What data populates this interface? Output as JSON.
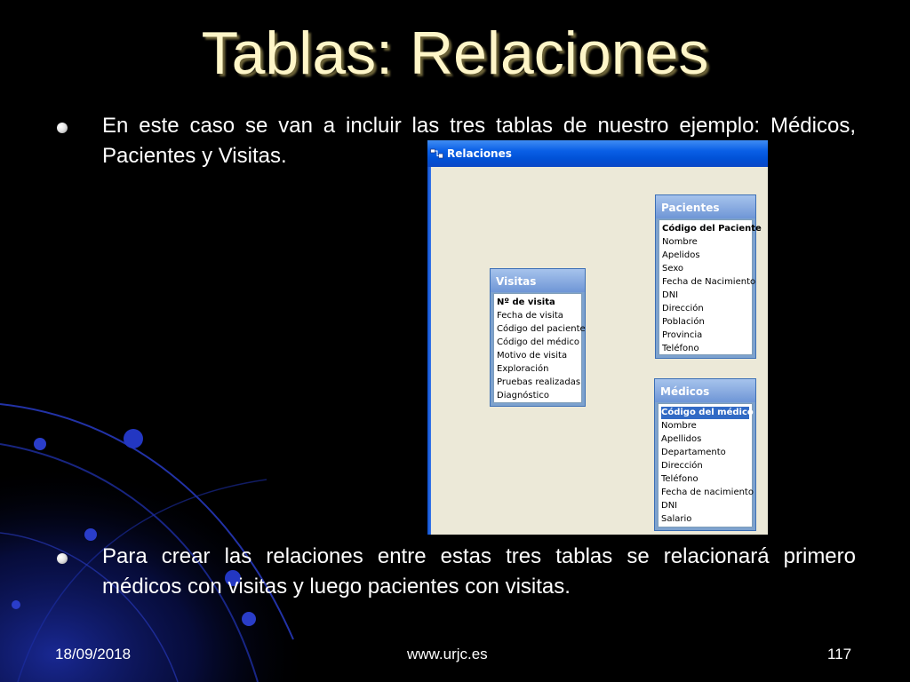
{
  "slide": {
    "title": "Tablas: Relaciones",
    "bullets": [
      "En este caso se van a incluir las tres tablas de nuestro ejemplo: Médicos, Pacientes y Visitas.",
      "Para crear las relaciones entre estas tres tablas se relacionará primero médicos con visitas y luego pacientes con visitas."
    ],
    "footer": {
      "date": "18/09/2018",
      "url": "www.urjc.es",
      "page": "117"
    }
  },
  "window": {
    "title": "Relaciones",
    "icon": "relationships-icon",
    "tables": {
      "visitas": {
        "title": "Visitas",
        "fields": [
          "Nº de visita",
          "Fecha de visita",
          "Código del paciente",
          "Código del médico",
          "Motivo de visita",
          "Exploración",
          "Pruebas realizadas",
          "Diagnóstico"
        ],
        "key_field": "Nº de visita"
      },
      "pacientes": {
        "title": "Pacientes",
        "fields": [
          "Código del Paciente",
          "Nombre",
          "Apelidos",
          "Sexo",
          "Fecha de Nacimiento",
          "DNI",
          "Dirección",
          "Población",
          "Provincia",
          "Teléfono"
        ],
        "key_field": "Código del Paciente"
      },
      "medicos": {
        "title": "Médicos",
        "fields": [
          "Código del médico",
          "Nombre",
          "Apellidos",
          "Departamento",
          "Dirección",
          "Teléfono",
          "Fecha de nacimiento",
          "DNI",
          "Salario"
        ],
        "key_field": "Código del médico",
        "selected_field": "Código del médico"
      }
    }
  },
  "colors": {
    "background": "#000000",
    "title_text": "#fff6c8",
    "body_text": "#ffffff",
    "titlebar_blue": "#0a5fe6",
    "window_face": "#ece9d8",
    "field_list_header": "#7da2ce",
    "selection": "#316ac5"
  }
}
